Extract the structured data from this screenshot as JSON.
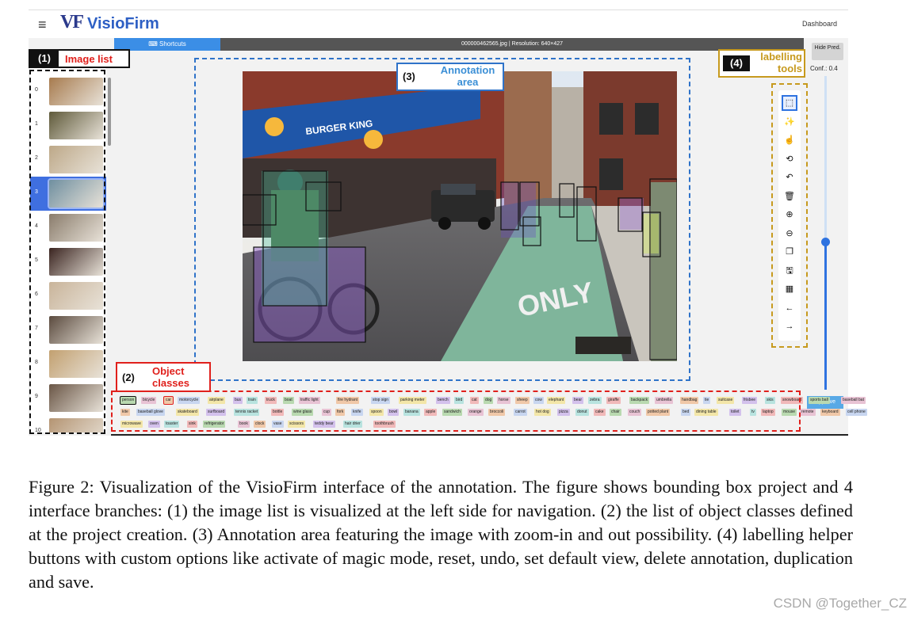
{
  "header": {
    "logo_mark": "VF",
    "app_name": "VisioFirm",
    "dashboard_label": "Dashboard"
  },
  "toolbar": {
    "shortcuts_label": "Shortcuts",
    "image_info": "000000462565.jpg | Resolution: 640×427"
  },
  "image_list": {
    "items": [
      {
        "index": "0",
        "color": "#a77b4e"
      },
      {
        "index": "1",
        "color": "#5f5a3a"
      },
      {
        "index": "2",
        "color": "#bda888"
      },
      {
        "index": "3",
        "color": "#6f8fa0"
      },
      {
        "index": "4",
        "color": "#8a7c6c"
      },
      {
        "index": "5",
        "color": "#3a2420"
      },
      {
        "index": "6",
        "color": "#c9b49a"
      },
      {
        "index": "7",
        "color": "#5b4b3f"
      },
      {
        "index": "8",
        "color": "#c2a070"
      },
      {
        "index": "9",
        "color": "#6a5646"
      },
      {
        "index": "10",
        "color": "#b49472"
      }
    ],
    "selected_index": 3
  },
  "tools": {
    "hide_pred_label": "Hide Pred.",
    "conf_label": "Conf.: 0.4",
    "conf_value": 0.4,
    "items": [
      {
        "icon": "bbox-tool-icon",
        "glyph": "⬚",
        "active": true
      },
      {
        "icon": "magic-wand-icon",
        "glyph": "✨",
        "active": false
      },
      {
        "icon": "pointer-click-icon",
        "glyph": "☝",
        "active": false
      },
      {
        "icon": "reset-view-icon",
        "glyph": "⟲",
        "active": false
      },
      {
        "icon": "undo-icon",
        "glyph": "↶",
        "active": false
      },
      {
        "icon": "delete-icon",
        "glyph": "🗑",
        "active": false
      },
      {
        "icon": "zoom-in-icon",
        "glyph": "⊕",
        "active": false
      },
      {
        "icon": "zoom-out-icon",
        "glyph": "⊖",
        "active": false
      },
      {
        "icon": "duplicate-icon",
        "glyph": "❐",
        "active": false
      },
      {
        "icon": "save-icon",
        "glyph": "🖫",
        "active": false
      },
      {
        "icon": "grid-icon",
        "glyph": "▦",
        "active": false
      },
      {
        "icon": "prev-arrow-icon",
        "glyph": "←",
        "active": false
      },
      {
        "icon": "next-arrow-icon",
        "glyph": "→",
        "active": false
      }
    ],
    "approve_label": "Approve"
  },
  "classes": {
    "row1": [
      "person",
      "bicycle",
      "car",
      "motorcycle",
      "airplane",
      "bus",
      "train",
      "truck",
      "boat",
      "traffic light",
      "fire hydrant",
      "stop sign",
      "parking meter",
      "bench",
      "bird",
      "cat",
      "dog",
      "horse",
      "sheep",
      "cow",
      "elephant",
      "bear",
      "zebra",
      "giraffe",
      "backpack",
      "umbrella",
      "handbag",
      "tie",
      "suitcase",
      "frisbee",
      "skis",
      "snowboard",
      "sports ball",
      "baseball bat"
    ],
    "row2": [
      "kite",
      "baseball glove",
      "skateboard",
      "surfboard",
      "tennis racket",
      "bottle",
      "wine glass",
      "cup",
      "fork",
      "knife",
      "spoon",
      "bowl",
      "banana",
      "apple",
      "sandwich",
      "orange",
      "broccoli",
      "carrot",
      "hot dog",
      "pizza",
      "donut",
      "cake",
      "chair",
      "couch",
      "potted plant",
      "bed",
      "dining table",
      "toilet",
      "tv",
      "laptop",
      "mouse",
      "remote",
      "keyboard",
      "cell phone"
    ],
    "row3": [
      "microwave",
      "oven",
      "toaster",
      "sink",
      "refrigerator",
      "book",
      "clock",
      "vase",
      "scissors",
      "teddy bear",
      "hair drier",
      "toothbrush"
    ],
    "palette": [
      "#b9d9b0",
      "#e8c3d4",
      "#f0c8a8",
      "#c8d6f0",
      "#f3e6a8",
      "#d3c1ec",
      "#b8e3df",
      "#f1b9b9"
    ]
  },
  "callouts": {
    "c1_num": "(1)",
    "c1_label": "Image list",
    "c2_num": "(2)",
    "c2_label_1": "Object",
    "c2_label_2": "classes",
    "c3_num": "(3)",
    "c3_label_1": "Annotation",
    "c3_label_2": "area",
    "c4_num": "(4)",
    "c4_label_1": "labelling",
    "c4_label_2": "tools"
  },
  "caption": "Figure 2: Visualization of the VisioFirm interface of the annotation. The figure shows bounding box project and 4 interface branches: (1) the image list is visualized at the left side for navigation. (2) the list of object classes defined at the project creation. (3) Annotation area featuring the image with zoom-in and out possibility. (4) labelling helper buttons with custom options like activate of magic mode, reset, undo, set default view, delete annotation, duplication and save.",
  "watermark": "CSDN @Together_CZ",
  "photo": {
    "sign_text": "BURGER KING",
    "lane_text": "ONLY"
  }
}
